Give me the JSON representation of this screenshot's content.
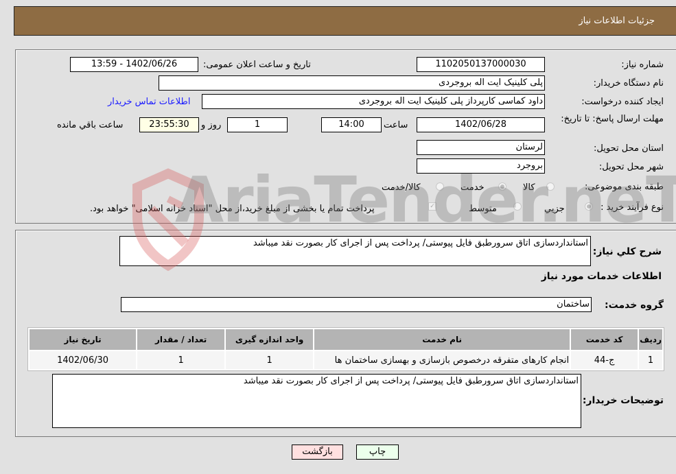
{
  "header": {
    "title": "جزئیات اطلاعات نیاز"
  },
  "need_info": {
    "need_number_label": "شماره نیاز:",
    "need_number": "1102050137000030",
    "announce_label": "تاریخ و ساعت اعلان عمومی:",
    "announce_value": "1402/06/26 - 13:59",
    "buyer_org_label": "نام دستگاه خریدار:",
    "buyer_org": "پلی کلینیک ایت اله بروجردی",
    "creator_label": "ایجاد کننده درخواست:",
    "creator": "داود کماسی کارپرداز پلی کلینیک ایت اله بروجردی",
    "contact_link": "اطلاعات تماس خریدار",
    "deadline_label": "مهلت ارسال پاسخ: تا تاریخ:",
    "deadline_date": "1402/06/28",
    "time_label": "ساعت",
    "deadline_time": "14:00",
    "days_value": "1",
    "days_label": "روز و",
    "remaining_value": "23:55:30",
    "remaining_label": "ساعت باقي مانده",
    "province_label": "استان محل تحویل:",
    "province": "لرستان",
    "city_label": "شهر محل تحویل:",
    "city": "بروجرد",
    "category_label": "طبقه بندی موضوعی:",
    "category_options": [
      {
        "label": "کالا",
        "selected": false
      },
      {
        "label": "خدمت",
        "selected": true
      },
      {
        "label": "کالا/خدمت",
        "selected": false
      }
    ],
    "process_label": "نوع فرآیند خرید :",
    "process_options": [
      {
        "label": "جزيي",
        "selected": true
      },
      {
        "label": "متوسط",
        "selected": false
      }
    ],
    "treasury_note": "پرداخت تمام یا بخشی از مبلغ خرید،از محل \"اسناد خزانه اسلامی\" خواهد بود.",
    "treasury_checked": true
  },
  "details": {
    "description_label": "شرح کلي نیاز:",
    "description": "استانداردسازی اتاق سرورطبق فایل پیوستی/ پرداخت پس از اجرای کار بصورت نقد میباشد",
    "services_title": "اطلاعات خدمات مورد نیاز",
    "service_group_label": "گروه خدمت:",
    "service_group": "ساختمان",
    "table": {
      "headers": [
        "ردیف",
        "کد خدمت",
        "نام خدمت",
        "واحد اندازه گیری",
        "تعداد / مقدار",
        "تاریخ نیاز"
      ],
      "rows": [
        [
          "1",
          "ج-44",
          "انجام کارهای متفرقه درخصوص بازسازی و بهسازی ساختمان ها",
          "1",
          "1",
          "1402/06/30"
        ]
      ]
    },
    "buyer_notes_label": "توضیحات خریدار:",
    "buyer_notes": "استانداردسازی اتاق سرورطبق فایل پیوستی/ پرداخت پس از اجرای کار بصورت نقد میباشد"
  },
  "buttons": {
    "print": "چاپ",
    "back": "بازگشت"
  },
  "watermark": {
    "text": "AriaTender.neT"
  }
}
